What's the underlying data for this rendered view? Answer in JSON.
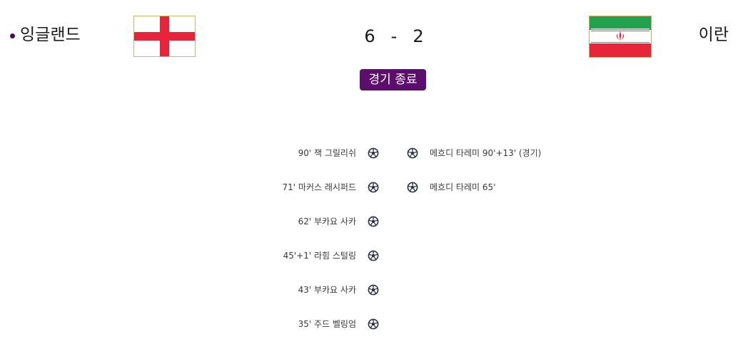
{
  "home": {
    "name": "잉글랜드",
    "flag_icon": "england-flag-icon",
    "colors": {
      "white": "#ffffff",
      "red": "#e8243a"
    }
  },
  "away": {
    "name": "이란",
    "flag_icon": "iran-flag-icon",
    "colors": {
      "green": "#23a24d",
      "white": "#ffffff",
      "red": "#e8243a"
    }
  },
  "score": {
    "home": "6",
    "separator": "-",
    "away": "2"
  },
  "status": {
    "label": "경기 종료",
    "color": "#5b0f6b"
  },
  "goals": {
    "home": [
      {
        "text": "90' 잭 그릴리쉬"
      },
      {
        "text": "71' 마커스 래시퍼드"
      },
      {
        "text": "62' 부카요 사카"
      },
      {
        "text": "45'+1' 라힘 스털링"
      },
      {
        "text": "43' 부카요 사카"
      },
      {
        "text": "35' 주드 벨링엄"
      }
    ],
    "away": [
      {
        "text": "메흐디 타레미 90'+13' (경기)"
      },
      {
        "text": "메흐디 타레미 65'"
      }
    ],
    "icon": "soccer-ball-icon"
  }
}
